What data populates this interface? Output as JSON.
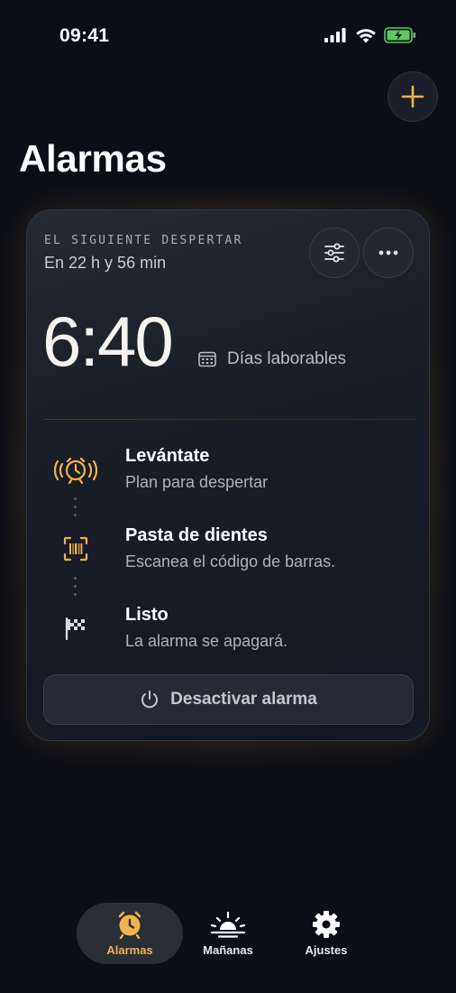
{
  "status_bar": {
    "time": "09:41"
  },
  "header": {
    "title": "Alarmas"
  },
  "card": {
    "next_label": "EL SIGUIENTE DESPERTAR",
    "next_time": "En 22 h y 56 min",
    "alarm_time": "6:40",
    "days": "Días laborables",
    "steps": [
      {
        "title": "Levántate",
        "subtitle": "Plan para despertar",
        "icon": "alarm-clock-ringing-icon"
      },
      {
        "title": "Pasta de dientes",
        "subtitle": "Escanea el código de barras.",
        "icon": "barcode-scan-icon"
      },
      {
        "title": "Listo",
        "subtitle": "La alarma se apagará.",
        "icon": "checkered-flag-icon"
      }
    ],
    "deactivate_label": "Desactivar alarma"
  },
  "tabs": [
    {
      "label": "Alarmas",
      "icon": "alarm-clock-icon",
      "active": true
    },
    {
      "label": "Mañanas",
      "icon": "sunrise-icon",
      "active": false
    },
    {
      "label": "Ajustes",
      "icon": "gear-icon",
      "active": false
    }
  ],
  "colors": {
    "accent": "#f2b24e",
    "background": "#0b0e15",
    "card": "#1a1e27"
  }
}
